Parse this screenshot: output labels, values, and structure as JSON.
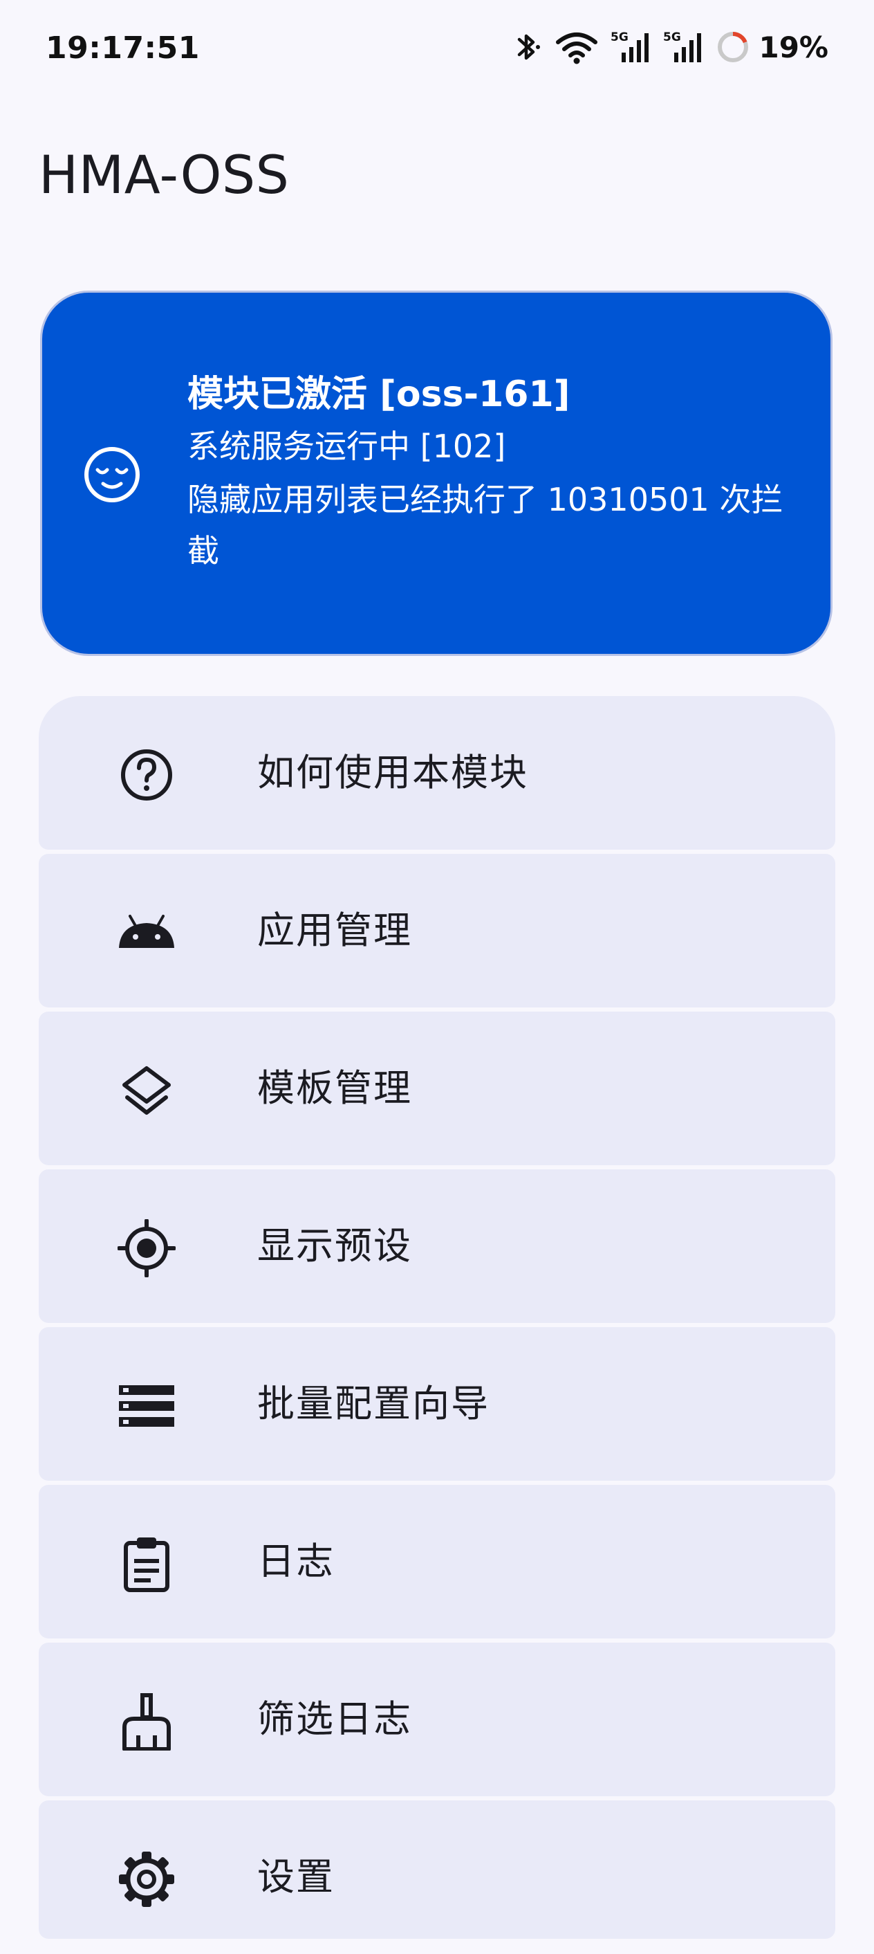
{
  "status_bar": {
    "time": "19:17:51",
    "network_label_1": "5G",
    "network_label_2": "5G",
    "battery_percent": "19%",
    "battery_level": 0.19,
    "icons": [
      "bluetooth-icon",
      "wifi-icon",
      "signal-5g-icon",
      "signal-5g-icon",
      "battery-ring-icon"
    ]
  },
  "app": {
    "title": "HMA-OSS"
  },
  "status_card": {
    "title": "模块已激活 [oss-161]",
    "service_line": "系统服务运行中 [102]",
    "intercept_line_1": "隐藏应用列表已经执行了 10310501 次拦",
    "intercept_line_2": "截",
    "icon": "relieved-face-icon",
    "background_color": "#0055d4"
  },
  "menu": {
    "items": [
      {
        "label": "如何使用本模块",
        "icon": "help-circle-icon"
      },
      {
        "label": "应用管理",
        "icon": "android-icon"
      },
      {
        "label": "模板管理",
        "icon": "layers-icon"
      },
      {
        "label": "显示预设",
        "icon": "gps-target-icon"
      },
      {
        "label": "批量配置向导",
        "icon": "storage-list-icon"
      },
      {
        "label": "日志",
        "icon": "clipboard-icon"
      },
      {
        "label": "筛选日志",
        "icon": "broom-icon"
      },
      {
        "label": "设置",
        "icon": "gear-icon"
      }
    ],
    "background_color": "#e9eaf8"
  }
}
